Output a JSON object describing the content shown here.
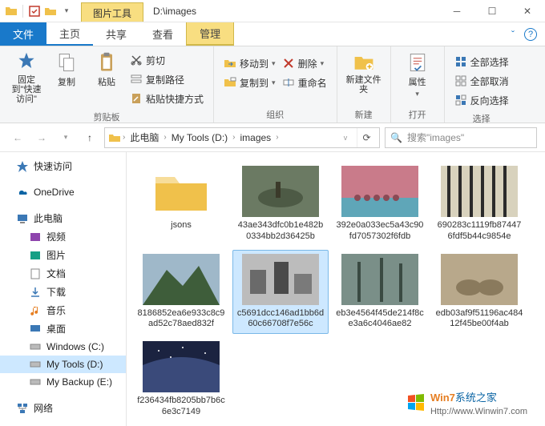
{
  "title_tab": "图片工具",
  "path_text": "D:\\images",
  "ribbon": {
    "file": "文件",
    "tabs": [
      "主页",
      "共享",
      "查看",
      "管理"
    ],
    "groups": {
      "clipboard": {
        "label": "剪贴板",
        "pin": "固定到\"快速访问\"",
        "copy": "复制",
        "paste": "粘贴",
        "cut": "剪切",
        "copy_path": "复制路径",
        "paste_shortcut": "粘贴快捷方式"
      },
      "organize": {
        "label": "组织",
        "move_to": "移动到",
        "copy_to": "复制到",
        "delete": "删除",
        "rename": "重命名"
      },
      "new": {
        "label": "新建",
        "new_folder": "新建文件夹"
      },
      "open": {
        "label": "打开",
        "properties": "属性"
      },
      "select": {
        "label": "选择",
        "select_all": "全部选择",
        "select_none": "全部取消",
        "invert": "反向选择"
      }
    }
  },
  "breadcrumb": [
    "此电脑",
    "My Tools (D:)",
    "images"
  ],
  "search_placeholder": "搜索\"images\"",
  "sidebar": {
    "quick": "快速访问",
    "onedrive": "OneDrive",
    "pc": "此电脑",
    "video": "视频",
    "pictures": "图片",
    "documents": "文档",
    "downloads": "下载",
    "music": "音乐",
    "desktop": "桌面",
    "cdrive": "Windows (C:)",
    "ddrive": "My Tools (D:)",
    "edrive": "My Backup (E:)",
    "network": "网络"
  },
  "items": [
    {
      "type": "folder",
      "name": "jsons"
    },
    {
      "type": "img",
      "name": "43ae343dfc0b1e482b0334bb2d36425b",
      "p": "wildlife"
    },
    {
      "type": "img",
      "name": "392e0a033ec5a43c90fd7057302f6fdb",
      "p": "sunset"
    },
    {
      "type": "img",
      "name": "690283c1119fb874476fdf5b44c9854e",
      "p": "zebra"
    },
    {
      "type": "img",
      "name": "8186852ea6e933c8c9ad52c78aed832f",
      "p": "mountain"
    },
    {
      "type": "img",
      "name": "c5691dcc146ad1bb6d60c66708f7e56c",
      "p": "bw",
      "selected": true
    },
    {
      "type": "img",
      "name": "eb3e4564f45de214f8ce3a6c4046ae82",
      "p": "forest"
    },
    {
      "type": "img",
      "name": "edb03af9f51196ac48412f45be00f4ab",
      "p": "animals"
    },
    {
      "type": "img",
      "name": "f236434fb8205bb7b6c6e3c7149",
      "p": "night"
    }
  ],
  "watermark": {
    "brand": "Win7",
    "text": "系统之家",
    "url": "Http://www.Winwin7.com"
  }
}
